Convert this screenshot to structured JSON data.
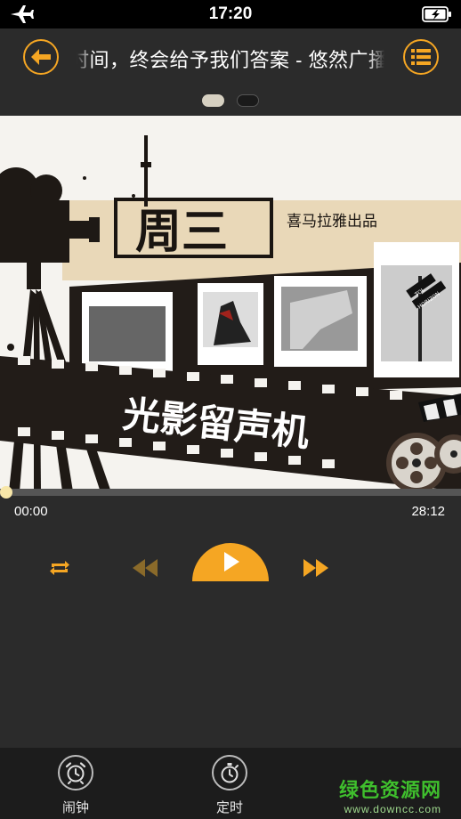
{
  "status_bar": {
    "time": "17:20",
    "airplane_icon": "airplane-icon",
    "battery_icon": "battery-charging-icon"
  },
  "header": {
    "title": "时间，终会给予我们答案 - 悠然广播",
    "back_icon": "arrow-left-icon",
    "playlist_icon": "list-icon",
    "pager": {
      "count": 2,
      "active": 0
    }
  },
  "cover": {
    "day_text": "周三",
    "publisher": "喜马拉雅出品",
    "show_title": "光影留声机",
    "sign_text_1": "TOL",
    "sign_text_2": "HORIZON"
  },
  "player": {
    "elapsed": "00:00",
    "duration": "28:12",
    "progress": 0.0,
    "repeat_icon": "repeat-icon",
    "prev_icon": "rewind-icon",
    "play_icon": "play-icon",
    "next_icon": "fast-forward-icon"
  },
  "bottom": {
    "alarm_label": "闹钟",
    "timer_label": "定时",
    "alarm_icon": "alarm-clock-icon",
    "timer_icon": "stopwatch-icon",
    "watermark_title": "绿色资源网",
    "watermark_url": "www.downcc.com"
  },
  "colors": {
    "accent": "#f5a623",
    "background": "#2b2b2b",
    "bottom_bar": "#1c1c1c",
    "watermark": "#3fbf2d"
  }
}
